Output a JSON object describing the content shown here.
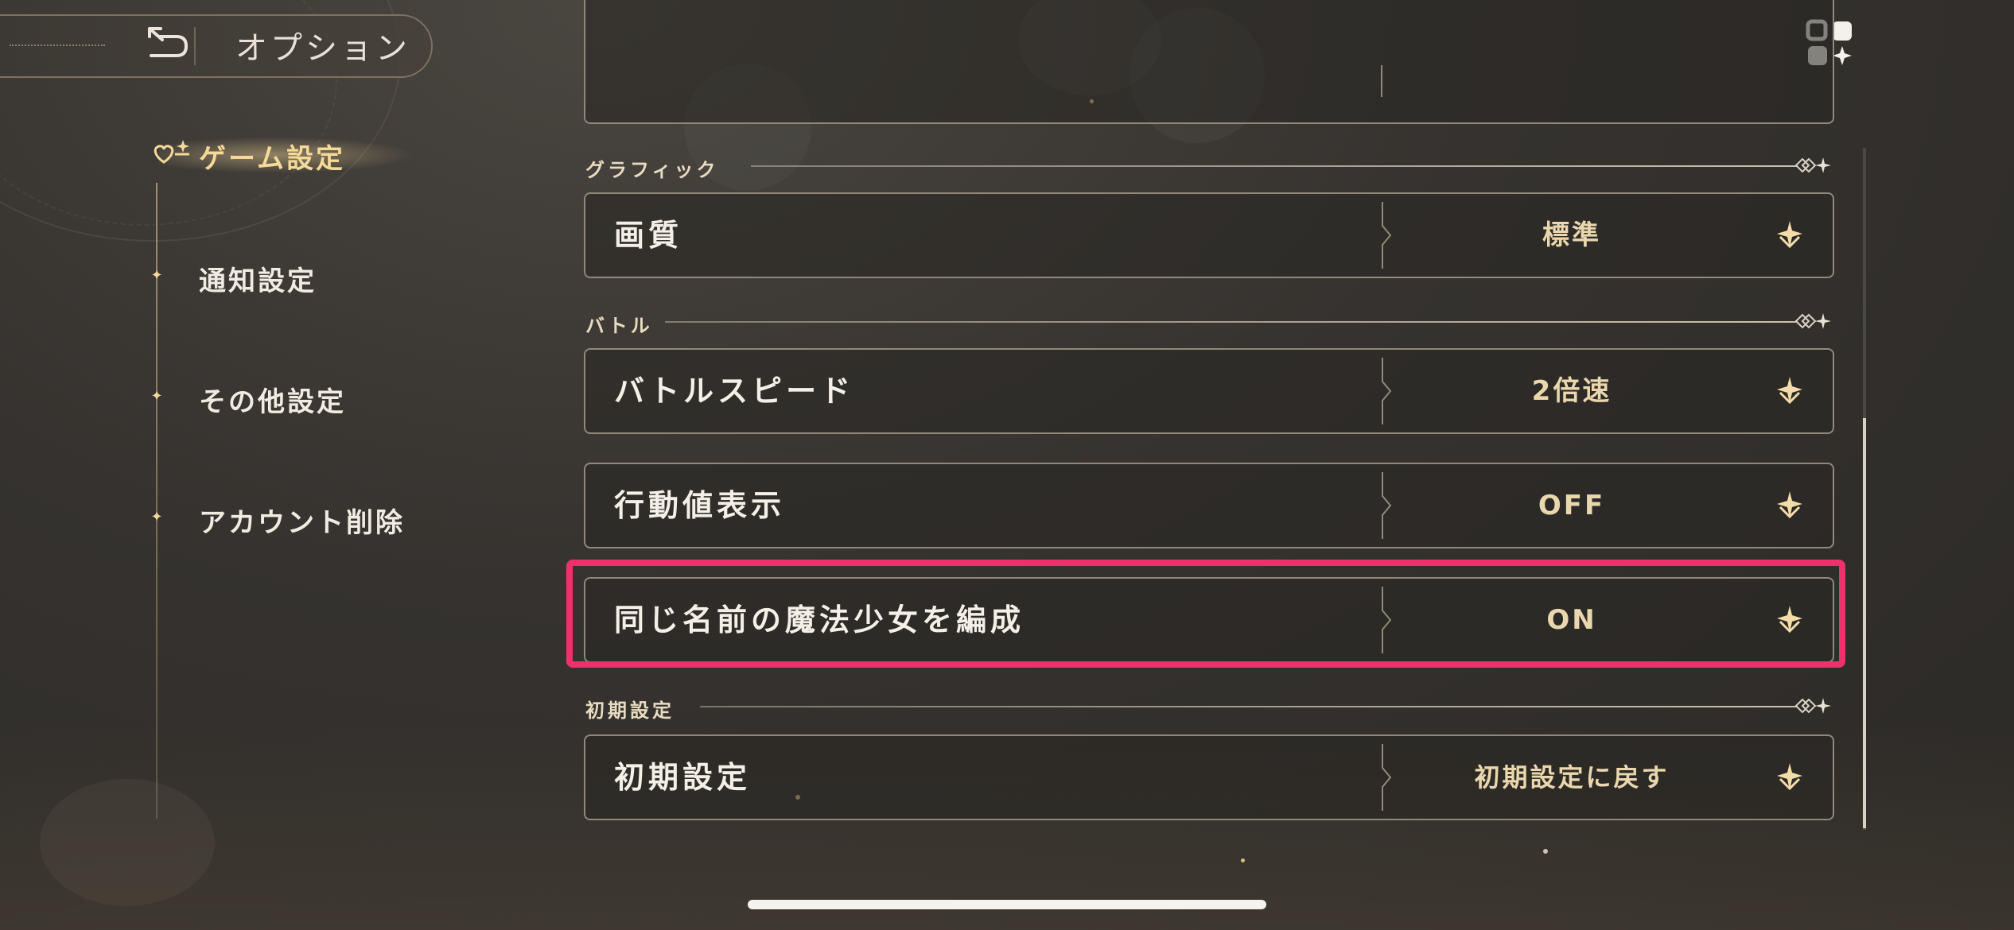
{
  "header": {
    "title": "オプション",
    "back_icon": "back-return-icon",
    "menu_icon": "grid-menu-icon"
  },
  "sidebar": {
    "items": [
      {
        "label": "ゲーム設定",
        "active": true
      },
      {
        "label": "通知設定",
        "active": false
      },
      {
        "label": "その他設定",
        "active": false
      },
      {
        "label": "アカウント削除",
        "active": false
      }
    ]
  },
  "sections": {
    "graphics": {
      "label": "グラフィック"
    },
    "battle": {
      "label": "バトル"
    },
    "reset": {
      "label": "初期設定"
    }
  },
  "settings": {
    "quality": {
      "label": "画質",
      "value": "標準"
    },
    "battle_speed": {
      "label": "バトルスピード",
      "value": "2倍速"
    },
    "action_value": {
      "label": "行動値表示",
      "value": "OFF"
    },
    "same_name": {
      "label": "同じ名前の魔法少女を編成",
      "value": "ON"
    },
    "reset": {
      "label": "初期設定",
      "value": "初期設定に戻す"
    }
  },
  "colors": {
    "highlight": "#f0306e",
    "accent_gold": "#ead7ae",
    "background": "#35322f"
  }
}
